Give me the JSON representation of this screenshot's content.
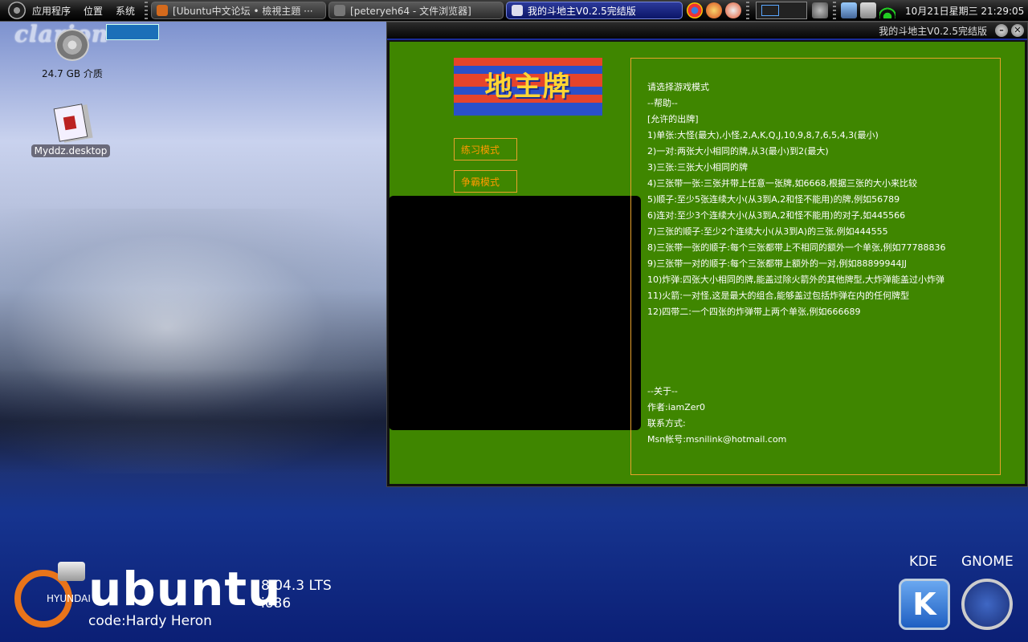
{
  "panel": {
    "menus": [
      "应用程序",
      "位置",
      "系统"
    ],
    "tasks": [
      {
        "label": "[Ubuntu中文论坛 • 檢視主題 ···"
      },
      {
        "label": "[peteryeh64 - 文件浏览器]"
      },
      {
        "label": "我的斗地主V0.2.5完结版"
      }
    ],
    "clock": "10月21日星期三  21:29:05"
  },
  "desktop": {
    "brand": "clarion",
    "icons": [
      {
        "label": "24.7 GB 介质"
      },
      {
        "label": "Myddz.desktop"
      }
    ]
  },
  "window": {
    "title": "我的斗地主V0.2.5完结版",
    "mode_buttons": [
      "练习模式",
      "争霸模式"
    ],
    "help_lines": [
      "请选择游戏模式",
      "--帮助--",
      "[允许的出牌]",
      "1)单张:大怪(最大),小怪,2,A,K,Q,J,10,9,8,7,6,5,4,3(最小)",
      "2)一对:两张大小相同的牌,从3(最小)到2(最大)",
      "3)三张:三张大小相同的牌",
      "4)三张带一张:三张并带上任意一张牌,如6668,根据三张的大小来比较",
      "5)顺子:至少5张连续大小(从3到A,2和怪不能用)的牌,例如56789",
      "6)连对:至少3个连续大小(从3到A,2和怪不能用)的对子,如445566",
      "7)三张的顺子:至少2个连续大小(从3到A)的三张,例如444555",
      "8)三张带一张的顺子:每个三张都带上不相同的额外一个单张,例如77788836",
      "9)三张带一对的顺子:每个三张都带上额外的一对,例如88899944JJ",
      "10)炸弹:四张大小相同的牌,能盖过除火箭外的其他牌型,大炸弹能盖过小炸弹",
      "11)火箭:一对怪,这是最大的组合,能够盖过包括炸弹在内的任何牌型",
      "12)四带二:一个四张的炸弹带上两个单张,例如666689"
    ],
    "about_lines": [
      "--关于--",
      "作者:iamZer0",
      "联系方式:",
      "Msn帐号:msnilink@hotmail.com"
    ]
  },
  "wallpaper": {
    "ubuntu_word": "ubuntu",
    "hyundai": "HYUNDAI",
    "version": "8.04.3 LTS",
    "arch": "i686",
    "codename": "code:Hardy Heron",
    "kde": "KDE",
    "gnome": "GNOME"
  },
  "colors": {
    "game_bg": "#3f8600",
    "button_text": "#ff9a00",
    "border": "#e8a22b"
  }
}
